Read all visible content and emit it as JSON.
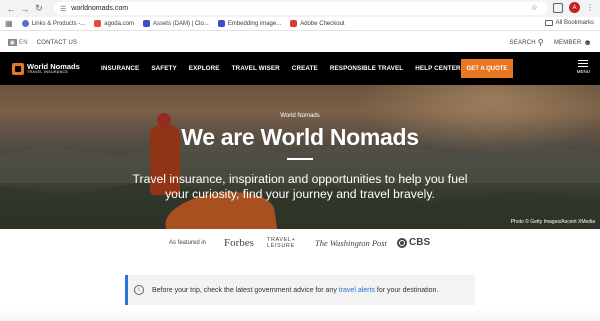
{
  "browser": {
    "url": "worldnomads.com",
    "bookmarks": [
      {
        "label": "Links & Products -...",
        "color": "#5b6ed6"
      },
      {
        "label": "agoda.com",
        "color": "#e8473c"
      },
      {
        "label": "Assets (DAM) | Clo...",
        "color": "#3b4fc4"
      },
      {
        "label": "Embedding image...",
        "color": "#3b4fc4"
      },
      {
        "label": "Adobe Checkout",
        "color": "#e03a2f"
      }
    ],
    "all_bookmarks": "All Bookmarks",
    "profile_initial": "A"
  },
  "utility": {
    "language": "EN",
    "contact": "CONTACT US",
    "search": "SEARCH",
    "member": "MEMBER"
  },
  "nav": {
    "brand": "World Nomads",
    "brand_sub": "TRAVEL INSURANCE",
    "items": [
      "INSURANCE",
      "SAFETY",
      "EXPLORE",
      "TRAVEL WISER",
      "CREATE",
      "RESPONSIBLE TRAVEL",
      "HELP CENTER"
    ],
    "quote": "GET A QUOTE",
    "menu": "MENU",
    "accent": "#e87722"
  },
  "hero": {
    "kicker": "World Nomads",
    "title": "We are World Nomads",
    "subtitle": "Travel insurance, inspiration and opportunities to help you fuel your curiosity, find your journey and travel bravely.",
    "credit": "Photo © Getty Images/Ascent XMedia"
  },
  "featured": {
    "label": "As featured in",
    "publications": [
      "Forbes",
      "TRAVEL+ LEISURE",
      "The Washington Post",
      "CBS"
    ]
  },
  "advisory": {
    "before": "Before your trip, check the latest government advice for any ",
    "link": "travel alerts",
    "after": " for your destination.",
    "accent": "#2a73d6"
  }
}
